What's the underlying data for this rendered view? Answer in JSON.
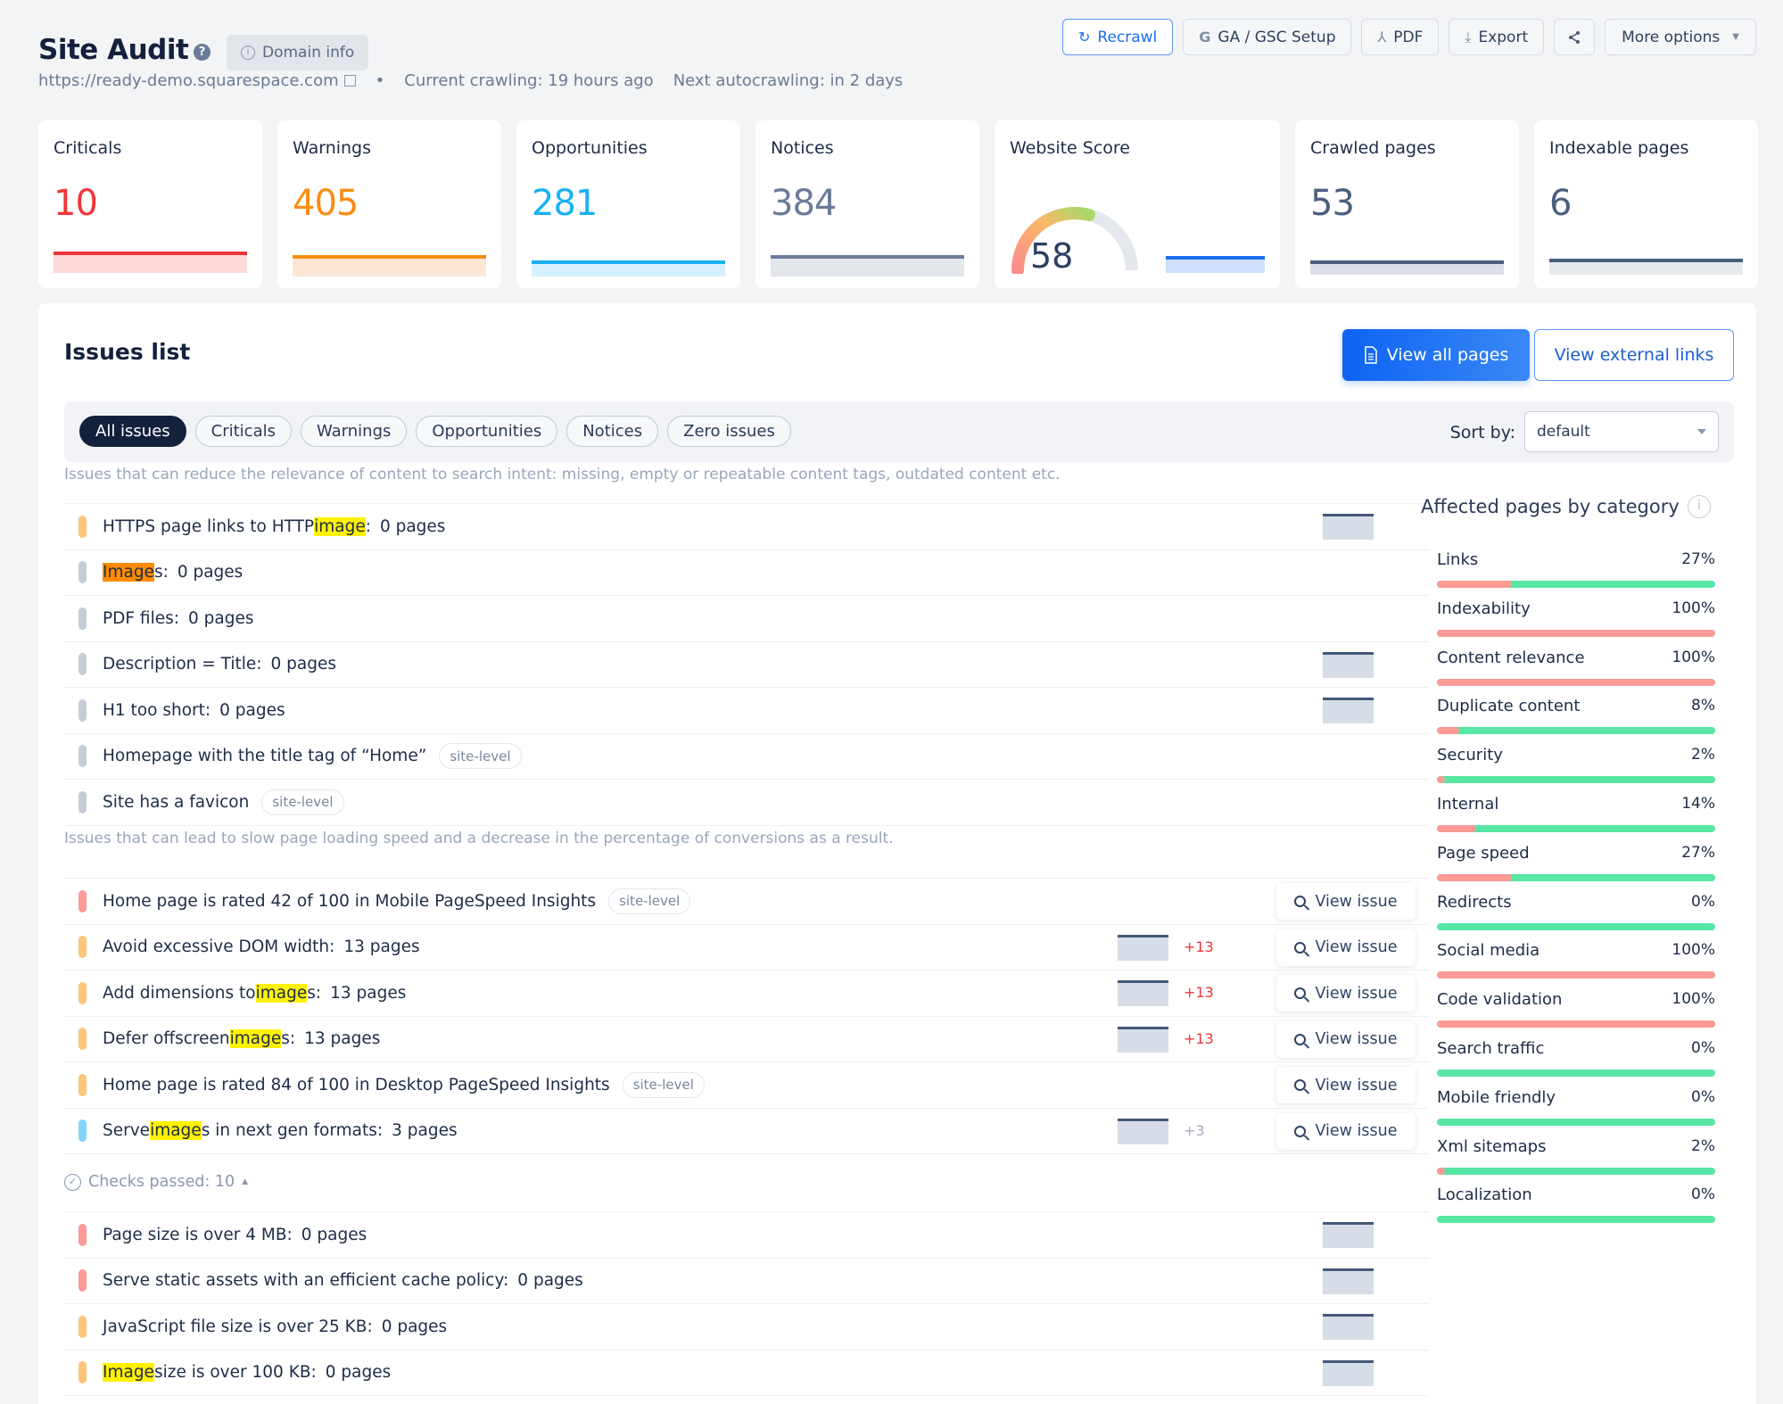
{
  "header": {
    "title": "Site Audit",
    "help_icon": "question-circle-icon",
    "domain_info_label": "Domain info",
    "url": "https://ready-demo.squarespace.com",
    "separator": "•",
    "current_crawling": "Current crawling: 19 hours ago",
    "next_autocrawling": "Next autocrawling: in 2 days",
    "actions": [
      {
        "label": "Recrawl",
        "icon": "refresh-icon"
      },
      {
        "label": "GA / GSC Setup",
        "icon": "google-icon"
      },
      {
        "label": "PDF",
        "icon": "pdf-icon"
      },
      {
        "label": "Export",
        "icon": "download-icon"
      },
      {
        "label": "",
        "icon": "share-icon"
      },
      {
        "label": "More options",
        "icon": "caret-down-icon"
      }
    ]
  },
  "stats": [
    {
      "label": "Criticals",
      "value": "10",
      "color": "#f0353a",
      "fill": "#fdd9d8"
    },
    {
      "label": "Warnings",
      "value": "405",
      "color": "#fb8c13",
      "fill": "#fde6d4"
    },
    {
      "label": "Opportunities",
      "value": "281",
      "color": "#19b1f2",
      "fill": "#d6f1fd"
    },
    {
      "label": "Notices",
      "value": "384",
      "color": "#6b7c99",
      "fill": "#e3e6eb"
    },
    {
      "label": "Website Score",
      "value": "58",
      "score_percent": 58,
      "color": "#1d6ef2",
      "fill": "#cfe0fc"
    },
    {
      "label": "Crawled pages",
      "value": "53",
      "color": "#4a5f80",
      "fill": "#dbe0e7"
    },
    {
      "label": "Indexable pages",
      "value": "6",
      "color": "#4a5f80",
      "fill": "#e6e9ee"
    }
  ],
  "issues": {
    "title": "Issues list",
    "view_all_pages": "View all pages",
    "view_external_links": "View external links",
    "filters": [
      "All issues",
      "Criticals",
      "Warnings",
      "Opportunities",
      "Notices",
      "Zero issues"
    ],
    "active_filter": "All issues",
    "sort_label": "Sort by:",
    "sort_value": "default",
    "view_issue_label": "View issue",
    "section1_desc": "Issues that can reduce the relevance of content to search intent: missing, empty or repeatable content tags, outdated content etc.",
    "section2_desc": "Issues that can lead to slow page loading speed and a decrease in the percentage of conversions as a result.",
    "checks_passed": "Checks passed: 10",
    "severity_colors": {
      "critical": "#fc9a95",
      "warning": "#fdc57a",
      "opportunity": "#82d4fb",
      "notice": "#c5ccd7"
    },
    "section1_rows": [
      {
        "pre": "HTTPS page links to HTTP ",
        "hl": "image",
        "post": ":",
        "count": "0 pages",
        "sev": "warning",
        "spark": true
      },
      {
        "pre": "",
        "hl": "Image",
        "post": "s:",
        "count": "0 pages",
        "sev": "notice",
        "hl_style": "orange"
      },
      {
        "pre": "PDF files:",
        "hl": "",
        "post": "",
        "count": "0 pages",
        "sev": "notice"
      },
      {
        "pre": "Description = Title:",
        "hl": "",
        "post": "",
        "count": "0 pages",
        "sev": "notice",
        "spark": true
      },
      {
        "pre": "H1 too short:",
        "hl": "",
        "post": "",
        "count": "0 pages",
        "sev": "notice",
        "spark": true
      },
      {
        "pre": "Homepage with the title tag of “Home”",
        "hl": "",
        "post": "",
        "count": "",
        "sev": "notice",
        "tag": "site-level"
      },
      {
        "pre": "Site has a favicon",
        "hl": "",
        "post": "",
        "count": "",
        "sev": "notice",
        "tag": "site-level"
      }
    ],
    "section2_rows": [
      {
        "pre": "Home page is rated 42 of 100 in Mobile PageSpeed Insights",
        "hl": "",
        "post": "",
        "count": "",
        "sev": "critical",
        "tag": "site-level",
        "view": true
      },
      {
        "pre": "Avoid excessive DOM width:",
        "hl": "",
        "post": "",
        "count": "13 pages",
        "sev": "warning",
        "spark": true,
        "delta": "+13",
        "delta_color": "#f0353a",
        "view": true
      },
      {
        "pre": "Add dimensions to ",
        "hl": "image",
        "post": "s:",
        "count": "13 pages",
        "sev": "warning",
        "spark": true,
        "delta": "+13",
        "delta_color": "#f0353a",
        "view": true
      },
      {
        "pre": "Defer offscreen ",
        "hl": "image",
        "post": "s:",
        "count": "13 pages",
        "sev": "warning",
        "spark": true,
        "delta": "+13",
        "delta_color": "#f0353a",
        "view": true
      },
      {
        "pre": "Home page is rated 84 of 100 in Desktop PageSpeed Insights",
        "hl": "",
        "post": "",
        "count": "",
        "sev": "warning",
        "tag": "site-level",
        "view": true
      },
      {
        "pre": "Serve ",
        "hl": "image",
        "post": "s in next gen formats:",
        "count": "3 pages",
        "sev": "opportunity",
        "spark": true,
        "delta": "+3",
        "delta_color": "#a3acba",
        "view": true
      }
    ],
    "passed_rows": [
      {
        "pre": "Page size is over 4 MB:",
        "hl": "",
        "post": "",
        "count": "0 pages",
        "sev": "critical",
        "spark": true
      },
      {
        "pre": "Serve static assets with an efficient cache policy:",
        "hl": "",
        "post": "",
        "count": "0 pages",
        "sev": "critical",
        "spark": true
      },
      {
        "pre": "JavaScript file size is over 25 KB:",
        "hl": "",
        "post": "",
        "count": "0 pages",
        "sev": "warning",
        "spark": true
      },
      {
        "pre": "",
        "hl": "Image",
        "post": " size is over 100 KB:",
        "count": "0 pages",
        "sev": "warning",
        "spark": true
      }
    ]
  },
  "affected": {
    "title": "Affected pages by category",
    "categories": [
      {
        "name": "Links",
        "percent": 27
      },
      {
        "name": "Indexability",
        "percent": 100
      },
      {
        "name": "Content relevance",
        "percent": 100
      },
      {
        "name": "Duplicate content",
        "percent": 8
      },
      {
        "name": "Security",
        "percent": 2
      },
      {
        "name": "Internal",
        "percent": 14
      },
      {
        "name": "Page speed",
        "percent": 27
      },
      {
        "name": "Redirects",
        "percent": 0
      },
      {
        "name": "Social media",
        "percent": 100
      },
      {
        "name": "Code validation",
        "percent": 100
      },
      {
        "name": "Search traffic",
        "percent": 0
      },
      {
        "name": "Mobile friendly",
        "percent": 0
      },
      {
        "name": "Xml sitemaps",
        "percent": 2
      },
      {
        "name": "Localization",
        "percent": 0
      }
    ]
  }
}
